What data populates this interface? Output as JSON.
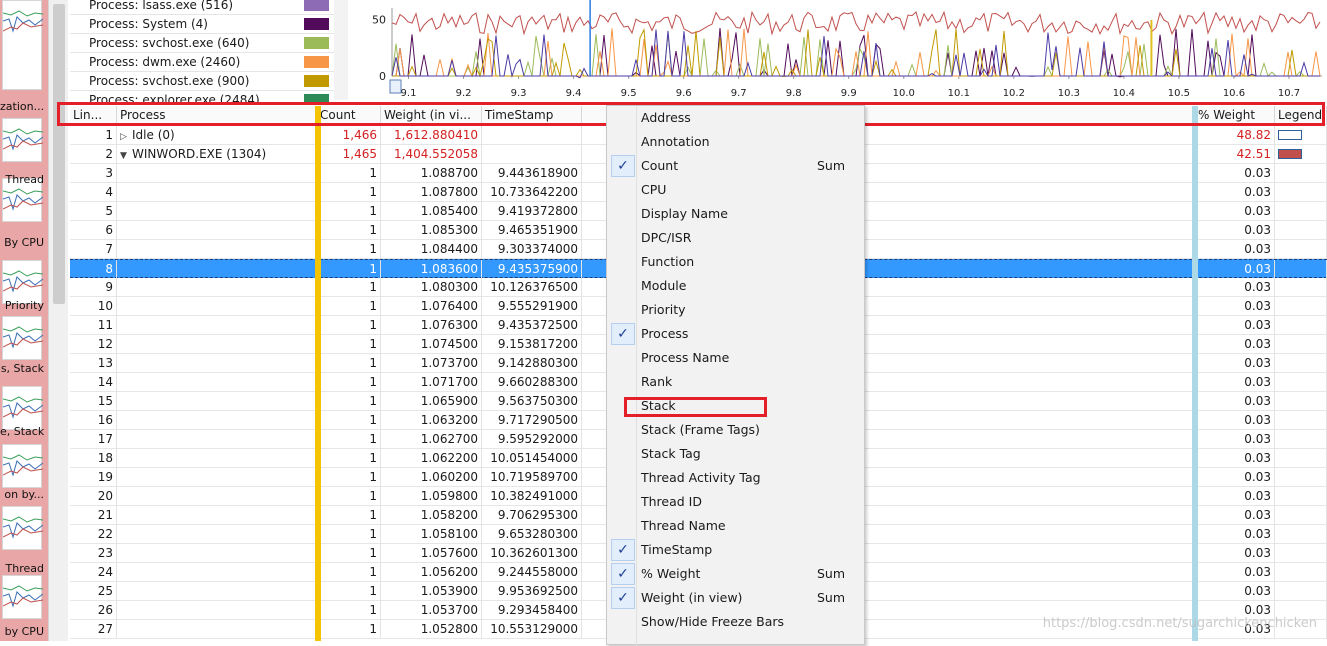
{
  "thumbnails": {
    "labels": [
      "zation...",
      "Thread",
      "By CPU",
      "Priority",
      "s, Stack",
      "e, Stack",
      "on by...",
      "Thread",
      "by CPU"
    ]
  },
  "legend": {
    "items": [
      {
        "label": "Process: lsass.exe (516)",
        "color": "#8e6bb5"
      },
      {
        "label": "Process: System (4)",
        "color": "#520a5a"
      },
      {
        "label": "Process: svchost.exe (640)",
        "color": "#9bbb59"
      },
      {
        "label": "Process: dwm.exe (2460)",
        "color": "#f79646"
      },
      {
        "label": "Process: svchost.exe (900)",
        "color": "#c09a00"
      },
      {
        "label": "Process: explorer.exe (2484)",
        "color": "#2e8b57"
      }
    ]
  },
  "chart_data": {
    "type": "line",
    "x_ticks": [
      "9.1",
      "9.2",
      "9.3",
      "9.4",
      "9.5",
      "9.6",
      "9.7",
      "9.8",
      "9.9",
      "10.0",
      "10.1",
      "10.2",
      "10.3",
      "10.4",
      "10.5",
      "10.6",
      "10.7"
    ],
    "y_ticks": [
      "50",
      "0"
    ],
    "xlim": [
      9.07,
      10.76
    ],
    "ylim": [
      0,
      60
    ],
    "cursor_x": 9.43,
    "highlight_x": 10.45
  },
  "grid": {
    "columns": [
      "Lin...",
      "Process",
      "Count",
      "Weight (in vi...",
      "TimeStamp",
      "% Weight",
      "Legend"
    ],
    "group_rows": [
      {
        "line": "1",
        "process": "Idle (0)",
        "count": "1,466",
        "weight": "1,612.880410",
        "pct": "48.82",
        "swatch": "#ffffff"
      },
      {
        "line": "2",
        "process": "WINWORD.EXE (1304)",
        "count": "1,465",
        "weight": "1,404.552058",
        "pct": "42.51",
        "swatch": "#c0504d"
      }
    ],
    "rows": [
      {
        "line": "3",
        "count": "1",
        "weight": "1.088700",
        "ts": "9.443618900",
        "pct": "0.03"
      },
      {
        "line": "4",
        "count": "1",
        "weight": "1.087800",
        "ts": "10.733642200",
        "pct": "0.03"
      },
      {
        "line": "5",
        "count": "1",
        "weight": "1.085400",
        "ts": "9.419372800",
        "pct": "0.03"
      },
      {
        "line": "6",
        "count": "1",
        "weight": "1.085300",
        "ts": "9.465351900",
        "pct": "0.03"
      },
      {
        "line": "7",
        "count": "1",
        "weight": "1.084400",
        "ts": "9.303374000",
        "pct": "0.03"
      },
      {
        "line": "8",
        "count": "1",
        "weight": "1.083600",
        "ts": "9.435375900",
        "pct": "0.03"
      },
      {
        "line": "9",
        "count": "1",
        "weight": "1.080300",
        "ts": "10.126376500",
        "pct": "0.03"
      },
      {
        "line": "10",
        "count": "1",
        "weight": "1.076400",
        "ts": "9.555291900",
        "pct": "0.03"
      },
      {
        "line": "11",
        "count": "1",
        "weight": "1.076300",
        "ts": "9.435372500",
        "pct": "0.03"
      },
      {
        "line": "12",
        "count": "1",
        "weight": "1.074500",
        "ts": "9.153817200",
        "pct": "0.03"
      },
      {
        "line": "13",
        "count": "1",
        "weight": "1.073700",
        "ts": "9.142880300",
        "pct": "0.03"
      },
      {
        "line": "14",
        "count": "1",
        "weight": "1.071700",
        "ts": "9.660288300",
        "pct": "0.03"
      },
      {
        "line": "15",
        "count": "1",
        "weight": "1.065900",
        "ts": "9.563750300",
        "pct": "0.03"
      },
      {
        "line": "16",
        "count": "1",
        "weight": "1.063200",
        "ts": "9.717290500",
        "pct": "0.03"
      },
      {
        "line": "17",
        "count": "1",
        "weight": "1.062700",
        "ts": "9.595292000",
        "pct": "0.03"
      },
      {
        "line": "18",
        "count": "1",
        "weight": "1.062200",
        "ts": "10.051454000",
        "pct": "0.03"
      },
      {
        "line": "19",
        "count": "1",
        "weight": "1.060200",
        "ts": "10.719589700",
        "pct": "0.03"
      },
      {
        "line": "20",
        "count": "1",
        "weight": "1.059800",
        "ts": "10.382491000",
        "pct": "0.03"
      },
      {
        "line": "21",
        "count": "1",
        "weight": "1.058200",
        "ts": "9.706295300",
        "pct": "0.03"
      },
      {
        "line": "22",
        "count": "1",
        "weight": "1.058100",
        "ts": "9.653280300",
        "pct": "0.03"
      },
      {
        "line": "23",
        "count": "1",
        "weight": "1.057600",
        "ts": "10.362601300",
        "pct": "0.03"
      },
      {
        "line": "24",
        "count": "1",
        "weight": "1.056200",
        "ts": "9.244558000",
        "pct": "0.03"
      },
      {
        "line": "25",
        "count": "1",
        "weight": "1.053900",
        "ts": "9.953692500",
        "pct": "0.03"
      },
      {
        "line": "26",
        "count": "1",
        "weight": "1.053700",
        "ts": "9.293458400",
        "pct": "0.03"
      },
      {
        "line": "27",
        "count": "1",
        "weight": "1.052800",
        "ts": "10.553129000",
        "pct": "0.03"
      }
    ],
    "selected_line": "8"
  },
  "menu": {
    "items": [
      {
        "label": "Address",
        "checked": false,
        "agg": ""
      },
      {
        "label": "Annotation",
        "checked": false,
        "agg": ""
      },
      {
        "label": "Count",
        "checked": true,
        "agg": "Sum"
      },
      {
        "label": "CPU",
        "checked": false,
        "agg": ""
      },
      {
        "label": "Display Name",
        "checked": false,
        "agg": ""
      },
      {
        "label": "DPC/ISR",
        "checked": false,
        "agg": ""
      },
      {
        "label": "Function",
        "checked": false,
        "agg": ""
      },
      {
        "label": "Module",
        "checked": false,
        "agg": ""
      },
      {
        "label": "Priority",
        "checked": false,
        "agg": ""
      },
      {
        "label": "Process",
        "checked": true,
        "agg": ""
      },
      {
        "label": "Process Name",
        "checked": false,
        "agg": ""
      },
      {
        "label": "Rank",
        "checked": false,
        "agg": ""
      },
      {
        "label": "Stack",
        "checked": false,
        "agg": ""
      },
      {
        "label": "Stack (Frame Tags)",
        "checked": false,
        "agg": ""
      },
      {
        "label": "Stack Tag",
        "checked": false,
        "agg": ""
      },
      {
        "label": "Thread Activity Tag",
        "checked": false,
        "agg": ""
      },
      {
        "label": "Thread ID",
        "checked": false,
        "agg": ""
      },
      {
        "label": "Thread Name",
        "checked": false,
        "agg": ""
      },
      {
        "label": "TimeStamp",
        "checked": true,
        "agg": ""
      },
      {
        "label": "% Weight",
        "checked": true,
        "agg": "Sum"
      },
      {
        "label": "Weight (in view)",
        "checked": true,
        "agg": "Sum"
      },
      {
        "label": "Show/Hide Freeze Bars",
        "checked": false,
        "agg": ""
      }
    ],
    "checkmark": "✓"
  },
  "watermark": "https://blog.csdn.net/sugarchickenchicken",
  "highlight_color": "#e3202a"
}
